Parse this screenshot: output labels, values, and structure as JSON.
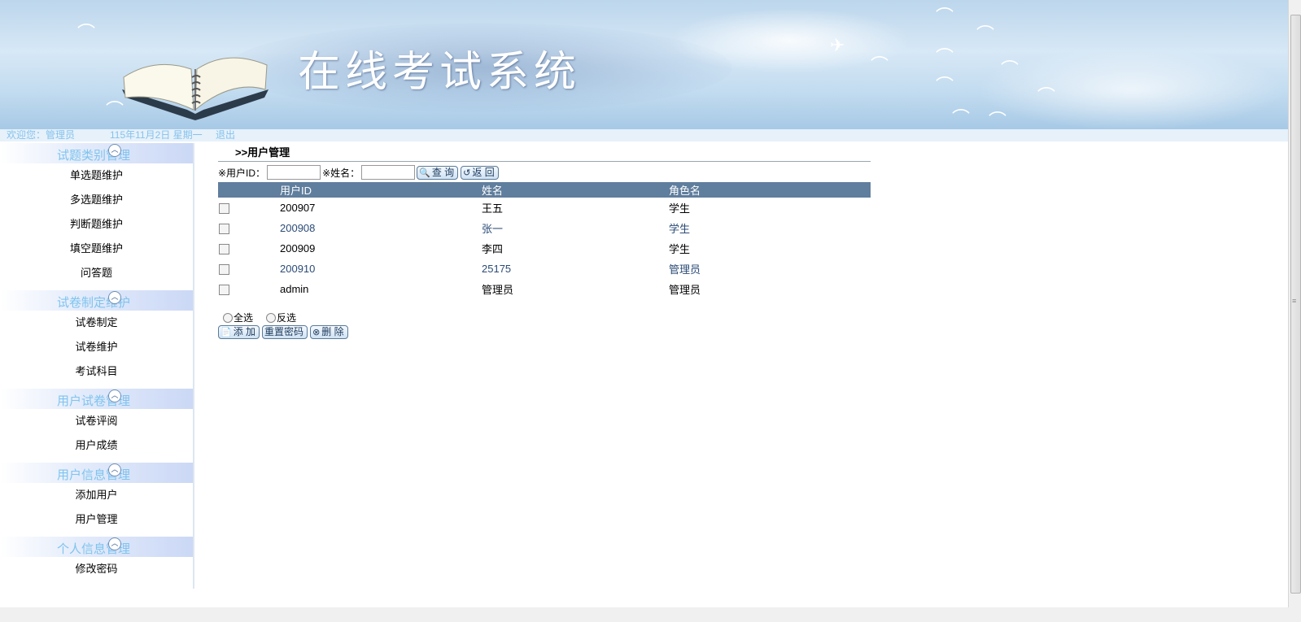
{
  "banner": {
    "title": "在线考试系统"
  },
  "status": {
    "welcome": "欢迎您：管理员",
    "date": "115年11月2日 星期一",
    "logout": "退出"
  },
  "sidebar": {
    "sections": [
      {
        "title": "试题类别管理",
        "items": [
          "单选题维护",
          "多选题维护",
          "判断题维护",
          "填空题维护",
          "问答题"
        ]
      },
      {
        "title": "试卷制定维护",
        "items": [
          "试卷制定",
          "试卷维护",
          "考试科目"
        ]
      },
      {
        "title": "用户试卷管理",
        "items": [
          "试卷评阅",
          "用户成绩"
        ]
      },
      {
        "title": "用户信息管理",
        "items": [
          "添加用户",
          "用户管理"
        ]
      },
      {
        "title": "个人信息管理",
        "items": [
          "修改密码"
        ]
      }
    ]
  },
  "main": {
    "page_title": ">>用户管理",
    "search": {
      "user_id_label": "※用户ID：",
      "user_id_value": "",
      "name_label": "※姓名：",
      "name_value": ""
    },
    "buttons": {
      "query": "查 询",
      "back": "返 回",
      "add": "添 加",
      "reset_password": "重置密码",
      "delete": "删 除"
    },
    "table": {
      "headers": [
        "用户ID",
        "姓名",
        "角色名"
      ],
      "rows": [
        {
          "id": "200907",
          "name": "王五",
          "role": "学生"
        },
        {
          "id": "200908",
          "name": "张一",
          "role": "学生"
        },
        {
          "id": "200909",
          "name": "李四",
          "role": "学生"
        },
        {
          "id": "200910",
          "name": "25175",
          "role": "管理员"
        },
        {
          "id": "admin",
          "name": "管理员",
          "role": "管理员"
        }
      ]
    },
    "select_all": "全选",
    "invert_select": "反选"
  },
  "colors": {
    "header_bg": "#607e9d",
    "accent_link": "#2b4b76",
    "sidebar_title": "#7fc4ee"
  }
}
